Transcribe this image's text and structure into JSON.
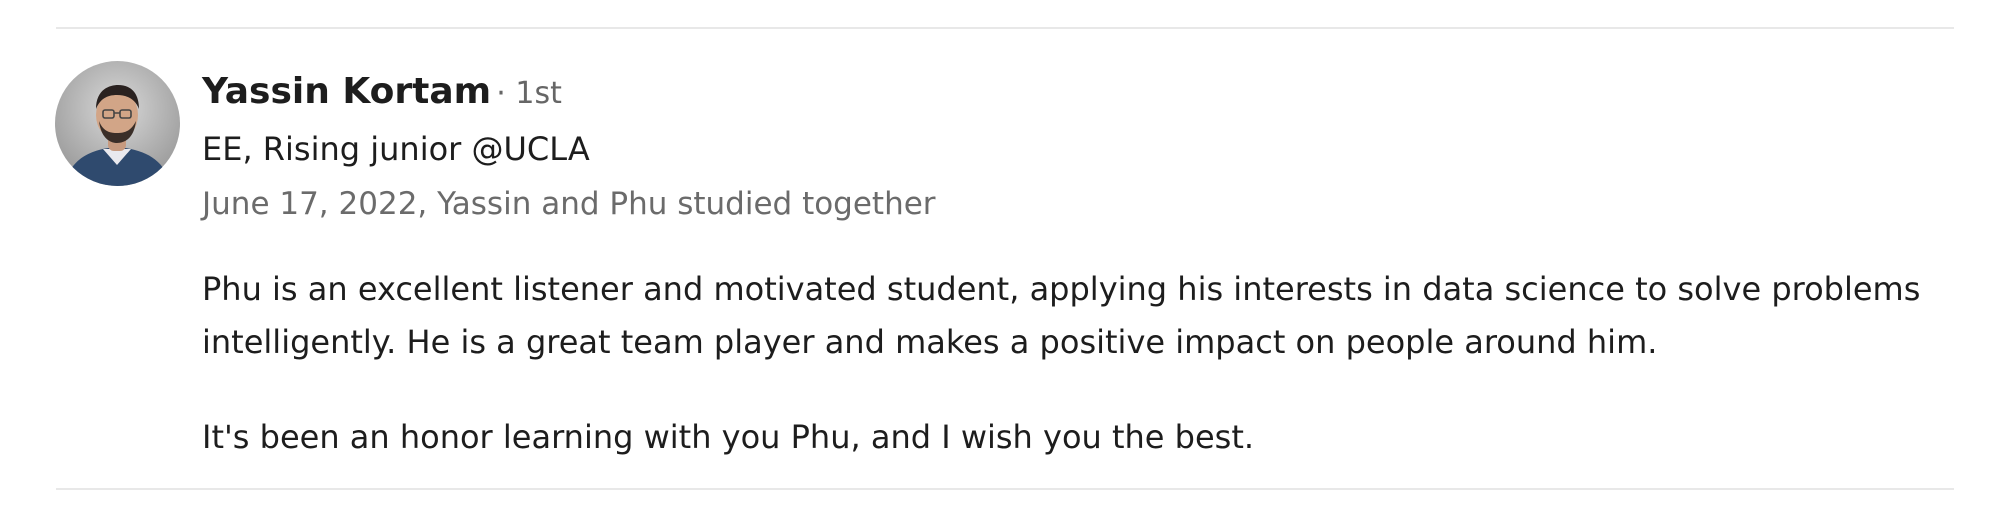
{
  "recommendation": {
    "author": {
      "name": "Yassin Kortam",
      "degree": "· 1st",
      "headline": "EE, Rising junior @UCLA"
    },
    "meta": "June 17, 2022, Yassin and Phu studied together",
    "text": {
      "line1": "Phu is an excellent listener and motivated student, applying his interests in data science to solve problems",
      "line2": "intelligently. He is a great team player and makes a positive impact on people around him.",
      "paragraph2": "It's been an honor learning with you Phu, and I wish you the best."
    }
  },
  "colors": {
    "name": "#1d1d1d",
    "secondary": "#666666",
    "divider": "#e8e8e8",
    "shirt": "#2f4a6e"
  }
}
